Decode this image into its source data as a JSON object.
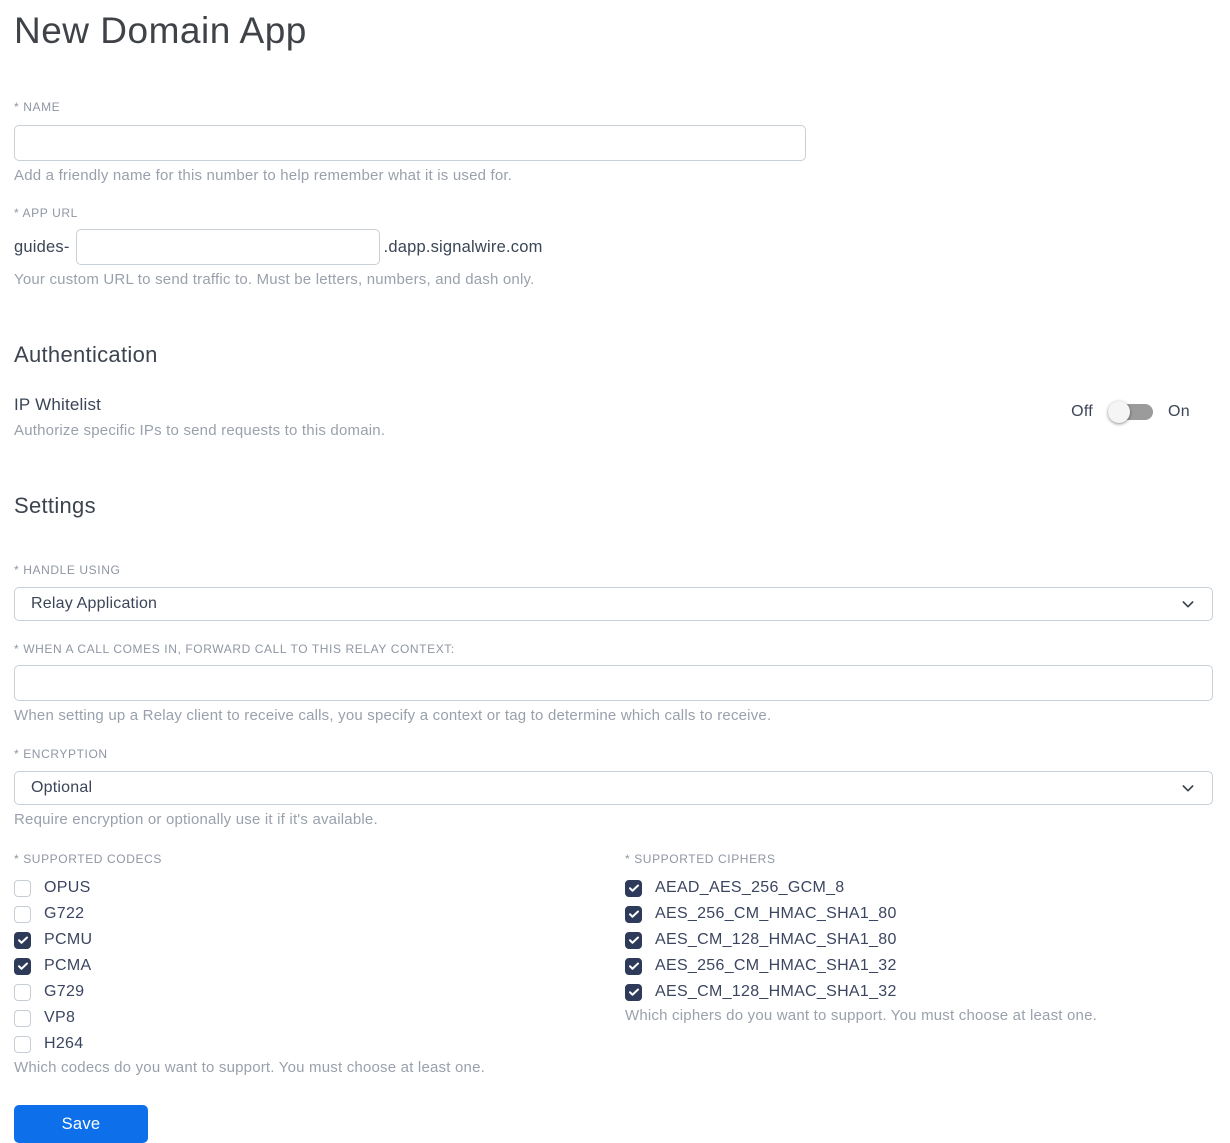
{
  "page": {
    "title": "New Domain App"
  },
  "colors": {
    "primary_blue": "#0d70ea",
    "checkbox_checked": "#2e3a59",
    "text_dark": "#3b4557",
    "text_muted": "#9aa1ac",
    "label_gray": "#8f96a3",
    "input_border": "#c9d0d6",
    "toggle_track": "#9b9b9b"
  },
  "name_field": {
    "label": "* NAME",
    "value": "",
    "helper": "Add a friendly name for this number to help remember what it is used for."
  },
  "app_url_field": {
    "label": "* APP URL",
    "prefix": "guides-",
    "value": "",
    "suffix": ".dapp.signalwire.com",
    "helper": "Your custom URL to send traffic to. Must be letters, numbers, and dash only."
  },
  "authentication": {
    "heading": "Authentication",
    "ip_whitelist": {
      "label": "IP Whitelist",
      "helper": "Authorize specific IPs to send requests to this domain.",
      "off_label": "Off",
      "on_label": "On",
      "state": "off"
    }
  },
  "settings": {
    "heading": "Settings",
    "handle_using": {
      "label": "* HANDLE USING",
      "value": "Relay Application"
    },
    "relay_context": {
      "label": "* WHEN A CALL COMES IN, FORWARD CALL TO THIS RELAY CONTEXT:",
      "value": "",
      "helper": "When setting up a Relay client to receive calls, you specify a context or tag to determine which calls to receive."
    },
    "encryption": {
      "label": "* ENCRYPTION",
      "value": "Optional",
      "helper": "Require encryption or optionally use it if it's available."
    },
    "codecs": {
      "label": "* SUPPORTED CODECS",
      "helper": "Which codecs do you want to support. You must choose at least one.",
      "items": [
        {
          "label": "OPUS",
          "checked": false
        },
        {
          "label": "G722",
          "checked": false
        },
        {
          "label": "PCMU",
          "checked": true
        },
        {
          "label": "PCMA",
          "checked": true
        },
        {
          "label": "G729",
          "checked": false
        },
        {
          "label": "VP8",
          "checked": false
        },
        {
          "label": "H264",
          "checked": false
        }
      ]
    },
    "ciphers": {
      "label": "* SUPPORTED CIPHERS",
      "helper": "Which ciphers do you want to support. You must choose at least one.",
      "items": [
        {
          "label": "AEAD_AES_256_GCM_8",
          "checked": true
        },
        {
          "label": "AES_256_CM_HMAC_SHA1_80",
          "checked": true
        },
        {
          "label": "AES_CM_128_HMAC_SHA1_80",
          "checked": true
        },
        {
          "label": "AES_256_CM_HMAC_SHA1_32",
          "checked": true
        },
        {
          "label": "AES_CM_128_HMAC_SHA1_32",
          "checked": true
        }
      ]
    }
  },
  "actions": {
    "save_label": "Save"
  }
}
